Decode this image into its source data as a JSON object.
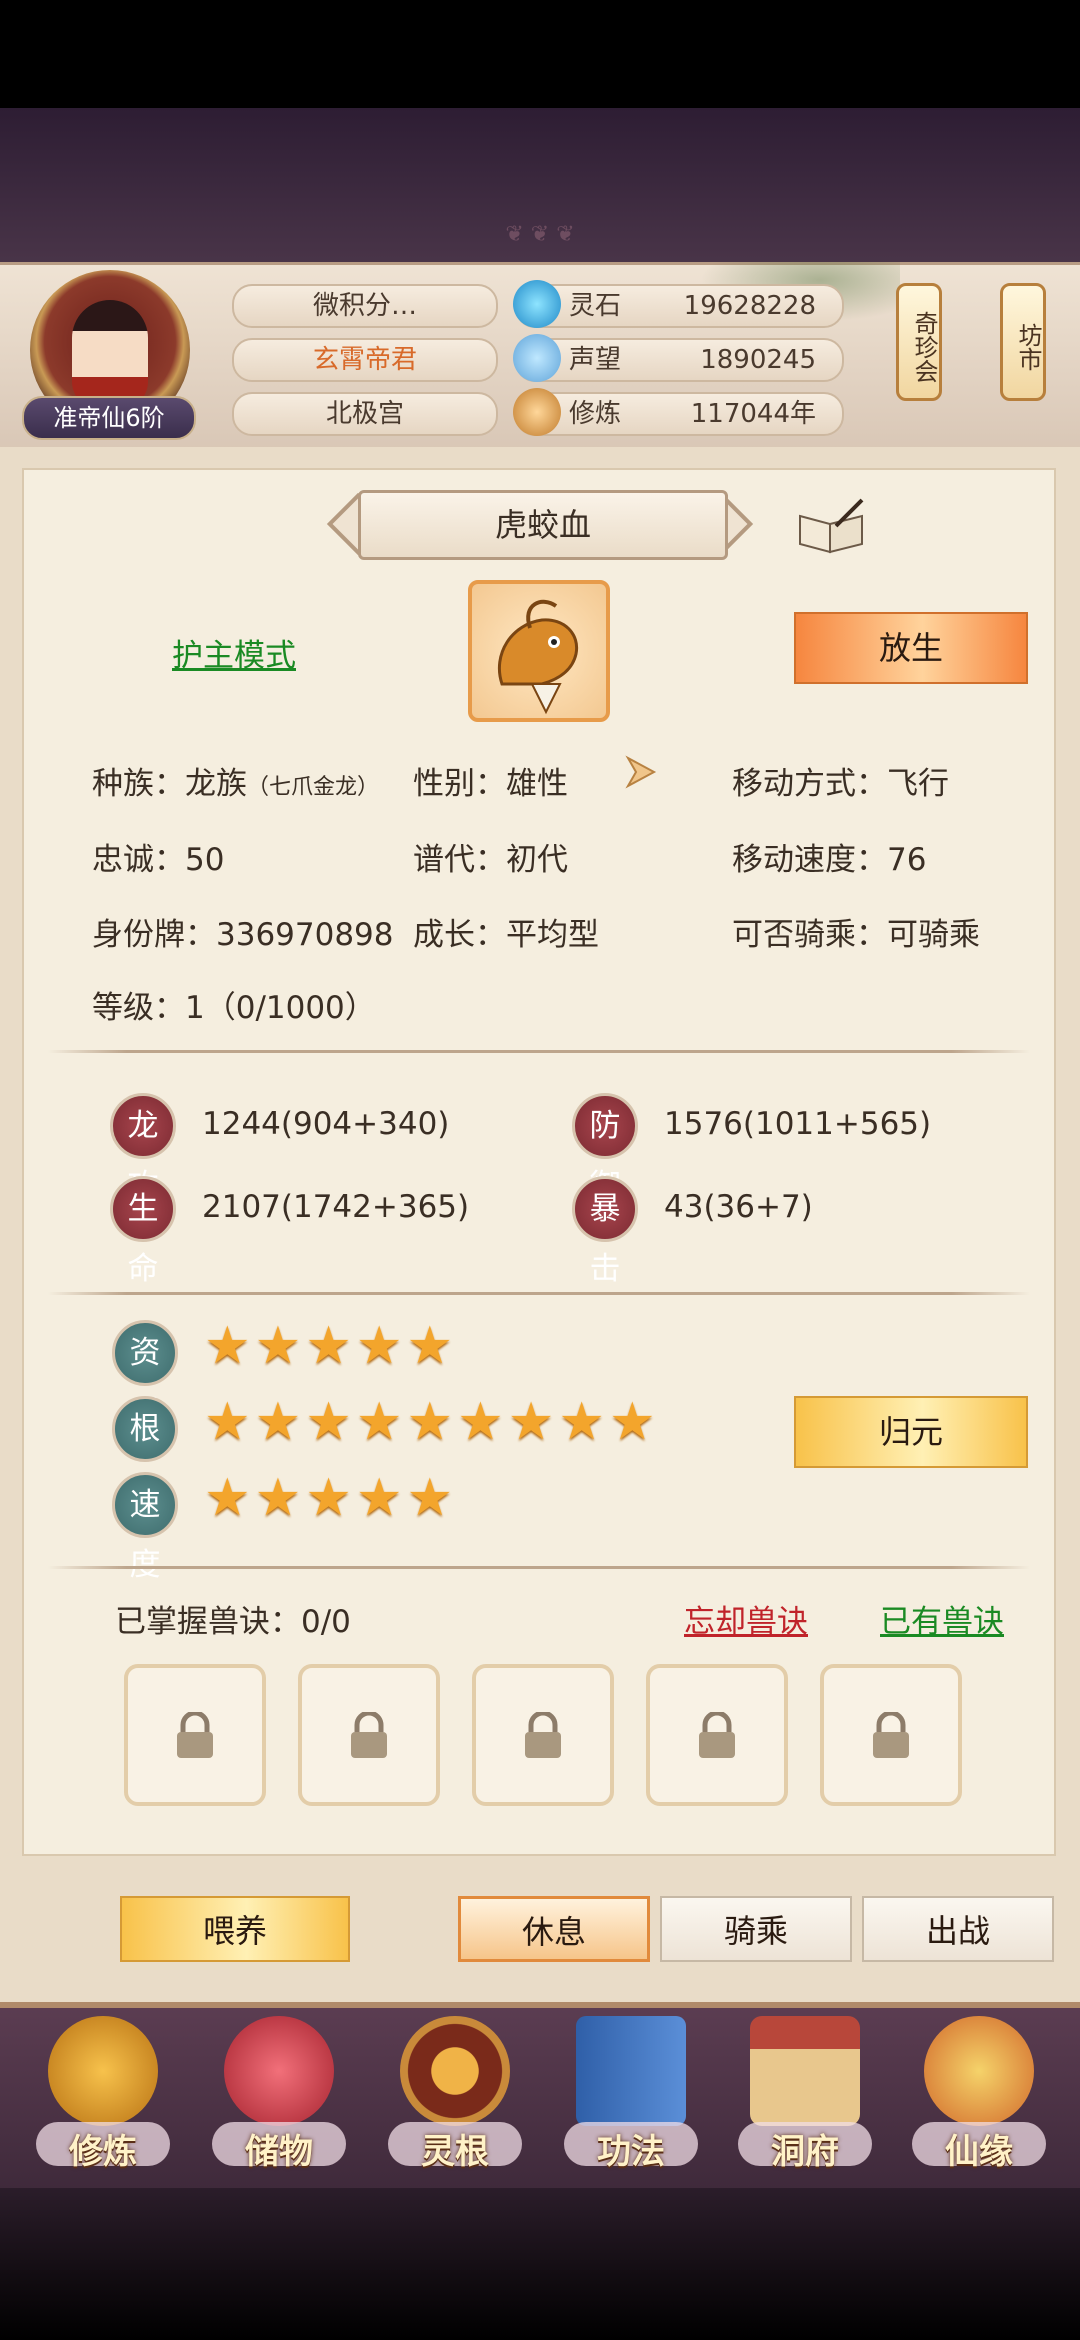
{
  "header": {
    "rank": "准帝仙6阶",
    "player_name": "微积分…",
    "title": "玄霄帝君",
    "sect": "北极宫",
    "resources": [
      {
        "icon": "spirit-stone-icon",
        "label": "灵石",
        "value": "19628228"
      },
      {
        "icon": "reputation-icon",
        "label": "声望",
        "value": "1890245"
      },
      {
        "icon": "cultivation-icon",
        "label": "修炼",
        "value": "117044年"
      }
    ],
    "lanterns": [
      "奇珍会",
      "坊市"
    ]
  },
  "pet": {
    "name": "虎蛟血",
    "mode_link": "护主模式",
    "release_button": "放生",
    "info": {
      "race": "种族：龙族",
      "race_sub": "（七爪金龙）",
      "gender": "性别：雄性",
      "move_type": "移动方式：飞行",
      "loyalty": "忠诚：50",
      "generation": "谱代：初代",
      "move_speed": "移动速度：76",
      "id_card": "身份牌：336970898",
      "growth": "成长：平均型",
      "rideable": "可否骑乘：可骑乘",
      "level": "等级：1（0/1000）"
    },
    "stats": [
      {
        "badge": "龙攻",
        "value": "1244(904+340)"
      },
      {
        "badge": "防御",
        "value": "1576(1011+565)"
      },
      {
        "badge": "生命",
        "value": "2107(1742+365)"
      },
      {
        "badge": "暴击",
        "value": "43(36+7)"
      }
    ],
    "aptitudes": [
      {
        "badge": "资质",
        "stars": 5
      },
      {
        "badge": "根骨",
        "stars": 9
      },
      {
        "badge": "速度",
        "stars": 5
      }
    ],
    "reset_button": "归元",
    "skills_label": "已掌握兽诀：0/0",
    "forget_link": "忘却兽诀",
    "owned_link": "已有兽诀"
  },
  "actions": {
    "feed": "喂养",
    "rest": "休息",
    "ride": "骑乘",
    "fight": "出战"
  },
  "nav": [
    "修炼",
    "储物",
    "灵根",
    "功法",
    "洞府",
    "仙缘"
  ],
  "colors": {
    "link_green": "#1a8a23",
    "link_red": "#c0232a",
    "title_orange": "#d86a2a",
    "star": "#f3a52c"
  }
}
